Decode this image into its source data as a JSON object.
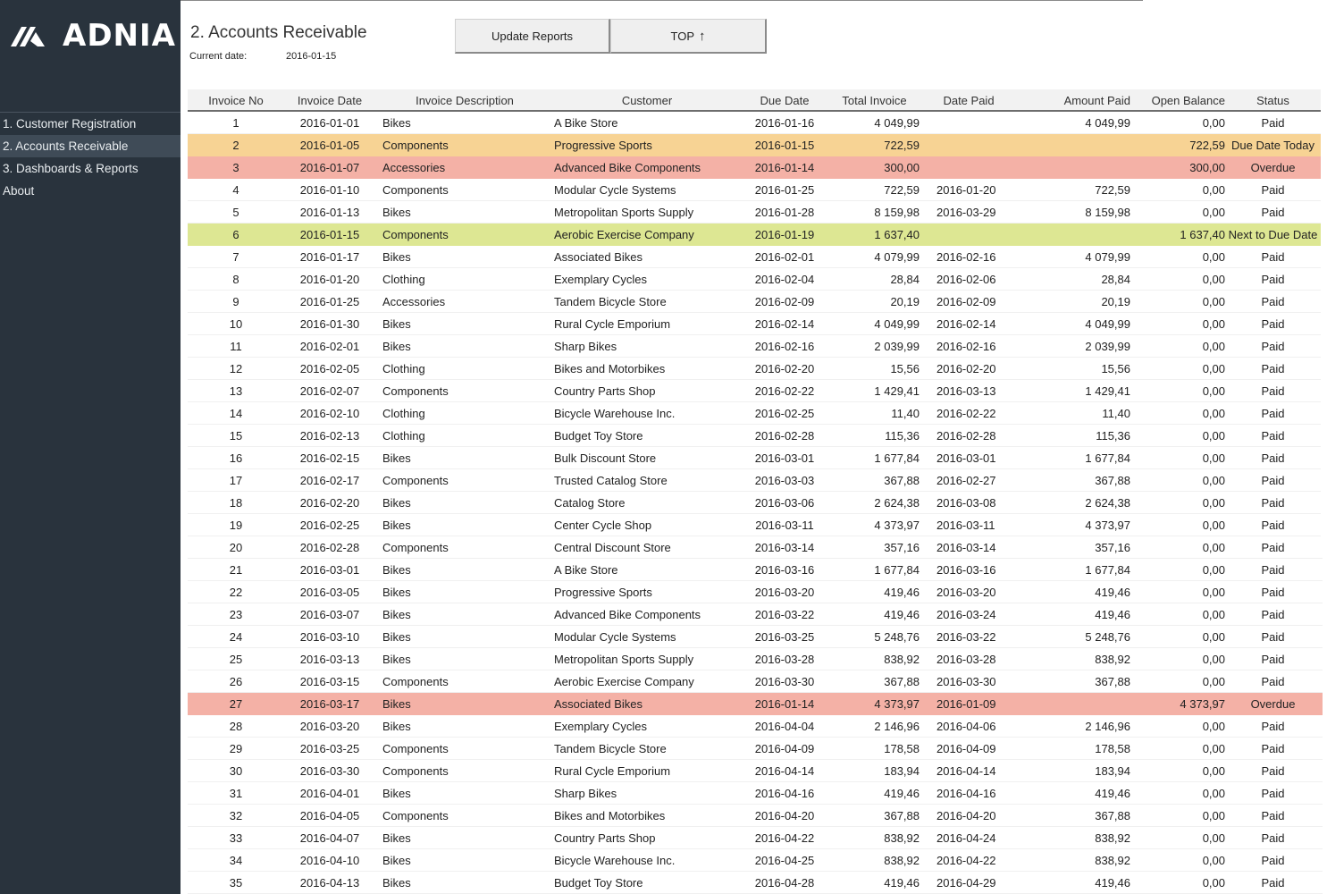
{
  "sidebar": {
    "logo_text": "ADNIA",
    "items": [
      {
        "label": "1. Customer Registration",
        "active": false
      },
      {
        "label": "2. Accounts Receivable",
        "active": true
      },
      {
        "label": "3. Dashboards & Reports",
        "active": false
      },
      {
        "label": "About",
        "active": false
      }
    ]
  },
  "header": {
    "title": "2. Accounts Receivable",
    "current_date_label": "Current date:",
    "current_date_value": "2016-01-15"
  },
  "toolbar": {
    "update_reports_label": "Update Reports",
    "top_label": "TOP",
    "top_arrow": "↑"
  },
  "status_colors": {
    "due_date_today": "#f7d394",
    "overdue": "#f4b1a6",
    "next_to_due_date": "#dde793",
    "paid": "#ffffff"
  },
  "table": {
    "columns": [
      "Invoice No",
      "Invoice Date",
      "Invoice Description",
      "Customer",
      "Due Date",
      "Total Invoice",
      "Date Paid",
      "Amount Paid",
      "Open Balance",
      "Status"
    ],
    "rows": [
      {
        "no": "1",
        "date": "2016-01-01",
        "desc": "Bikes",
        "customer": "A Bike Store",
        "due": "2016-01-16",
        "total": "4 049,99",
        "paid_date": "",
        "amount_paid": "4 049,99",
        "open": "0,00",
        "status": "Paid"
      },
      {
        "no": "2",
        "date": "2016-01-05",
        "desc": "Components",
        "customer": "Progressive Sports",
        "due": "2016-01-15",
        "total": "722,59",
        "paid_date": "",
        "amount_paid": "",
        "open": "722,59",
        "status": "Due Date Today"
      },
      {
        "no": "3",
        "date": "2016-01-07",
        "desc": "Accessories",
        "customer": "Advanced Bike Components",
        "due": "2016-01-14",
        "total": "300,00",
        "paid_date": "",
        "amount_paid": "",
        "open": "300,00",
        "status": "Overdue"
      },
      {
        "no": "4",
        "date": "2016-01-10",
        "desc": "Components",
        "customer": "Modular Cycle Systems",
        "due": "2016-01-25",
        "total": "722,59",
        "paid_date": "2016-01-20",
        "amount_paid": "722,59",
        "open": "0,00",
        "status": "Paid"
      },
      {
        "no": "5",
        "date": "2016-01-13",
        "desc": "Bikes",
        "customer": "Metropolitan Sports Supply",
        "due": "2016-01-28",
        "total": "8 159,98",
        "paid_date": "2016-03-29",
        "amount_paid": "8 159,98",
        "open": "0,00",
        "status": "Paid"
      },
      {
        "no": "6",
        "date": "2016-01-15",
        "desc": "Components",
        "customer": "Aerobic Exercise Company",
        "due": "2016-01-19",
        "total": "1 637,40",
        "paid_date": "",
        "amount_paid": "",
        "open": "1 637,40",
        "status": "Next to Due Date"
      },
      {
        "no": "7",
        "date": "2016-01-17",
        "desc": "Bikes",
        "customer": "Associated Bikes",
        "due": "2016-02-01",
        "total": "4 079,99",
        "paid_date": "2016-02-16",
        "amount_paid": "4 079,99",
        "open": "0,00",
        "status": "Paid"
      },
      {
        "no": "8",
        "date": "2016-01-20",
        "desc": "Clothing",
        "customer": "Exemplary Cycles",
        "due": "2016-02-04",
        "total": "28,84",
        "paid_date": "2016-02-06",
        "amount_paid": "28,84",
        "open": "0,00",
        "status": "Paid"
      },
      {
        "no": "9",
        "date": "2016-01-25",
        "desc": "Accessories",
        "customer": "Tandem Bicycle Store",
        "due": "2016-02-09",
        "total": "20,19",
        "paid_date": "2016-02-09",
        "amount_paid": "20,19",
        "open": "0,00",
        "status": "Paid"
      },
      {
        "no": "10",
        "date": "2016-01-30",
        "desc": "Bikes",
        "customer": "Rural Cycle Emporium",
        "due": "2016-02-14",
        "total": "4 049,99",
        "paid_date": "2016-02-14",
        "amount_paid": "4 049,99",
        "open": "0,00",
        "status": "Paid"
      },
      {
        "no": "11",
        "date": "2016-02-01",
        "desc": "Bikes",
        "customer": "Sharp Bikes",
        "due": "2016-02-16",
        "total": "2 039,99",
        "paid_date": "2016-02-16",
        "amount_paid": "2 039,99",
        "open": "0,00",
        "status": "Paid"
      },
      {
        "no": "12",
        "date": "2016-02-05",
        "desc": "Clothing",
        "customer": "Bikes and Motorbikes",
        "due": "2016-02-20",
        "total": "15,56",
        "paid_date": "2016-02-20",
        "amount_paid": "15,56",
        "open": "0,00",
        "status": "Paid"
      },
      {
        "no": "13",
        "date": "2016-02-07",
        "desc": "Components",
        "customer": "Country Parts Shop",
        "due": "2016-02-22",
        "total": "1 429,41",
        "paid_date": "2016-03-13",
        "amount_paid": "1 429,41",
        "open": "0,00",
        "status": "Paid"
      },
      {
        "no": "14",
        "date": "2016-02-10",
        "desc": "Clothing",
        "customer": "Bicycle Warehouse Inc.",
        "due": "2016-02-25",
        "total": "11,40",
        "paid_date": "2016-02-22",
        "amount_paid": "11,40",
        "open": "0,00",
        "status": "Paid"
      },
      {
        "no": "15",
        "date": "2016-02-13",
        "desc": "Clothing",
        "customer": "Budget Toy Store",
        "due": "2016-02-28",
        "total": "115,36",
        "paid_date": "2016-02-28",
        "amount_paid": "115,36",
        "open": "0,00",
        "status": "Paid"
      },
      {
        "no": "16",
        "date": "2016-02-15",
        "desc": "Bikes",
        "customer": "Bulk Discount Store",
        "due": "2016-03-01",
        "total": "1 677,84",
        "paid_date": "2016-03-01",
        "amount_paid": "1 677,84",
        "open": "0,00",
        "status": "Paid"
      },
      {
        "no": "17",
        "date": "2016-02-17",
        "desc": "Components",
        "customer": "Trusted Catalog Store",
        "due": "2016-03-03",
        "total": "367,88",
        "paid_date": "2016-02-27",
        "amount_paid": "367,88",
        "open": "0,00",
        "status": "Paid"
      },
      {
        "no": "18",
        "date": "2016-02-20",
        "desc": "Bikes",
        "customer": "Catalog Store",
        "due": "2016-03-06",
        "total": "2 624,38",
        "paid_date": "2016-03-08",
        "amount_paid": "2 624,38",
        "open": "0,00",
        "status": "Paid"
      },
      {
        "no": "19",
        "date": "2016-02-25",
        "desc": "Bikes",
        "customer": "Center Cycle Shop",
        "due": "2016-03-11",
        "total": "4 373,97",
        "paid_date": "2016-03-11",
        "amount_paid": "4 373,97",
        "open": "0,00",
        "status": "Paid"
      },
      {
        "no": "20",
        "date": "2016-02-28",
        "desc": "Components",
        "customer": "Central Discount Store",
        "due": "2016-03-14",
        "total": "357,16",
        "paid_date": "2016-03-14",
        "amount_paid": "357,16",
        "open": "0,00",
        "status": "Paid"
      },
      {
        "no": "21",
        "date": "2016-03-01",
        "desc": "Bikes",
        "customer": "A Bike Store",
        "due": "2016-03-16",
        "total": "1 677,84",
        "paid_date": "2016-03-16",
        "amount_paid": "1 677,84",
        "open": "0,00",
        "status": "Paid"
      },
      {
        "no": "22",
        "date": "2016-03-05",
        "desc": "Bikes",
        "customer": "Progressive Sports",
        "due": "2016-03-20",
        "total": "419,46",
        "paid_date": "2016-03-20",
        "amount_paid": "419,46",
        "open": "0,00",
        "status": "Paid"
      },
      {
        "no": "23",
        "date": "2016-03-07",
        "desc": "Bikes",
        "customer": "Advanced Bike Components",
        "due": "2016-03-22",
        "total": "419,46",
        "paid_date": "2016-03-24",
        "amount_paid": "419,46",
        "open": "0,00",
        "status": "Paid"
      },
      {
        "no": "24",
        "date": "2016-03-10",
        "desc": "Bikes",
        "customer": "Modular Cycle Systems",
        "due": "2016-03-25",
        "total": "5 248,76",
        "paid_date": "2016-03-22",
        "amount_paid": "5 248,76",
        "open": "0,00",
        "status": "Paid"
      },
      {
        "no": "25",
        "date": "2016-03-13",
        "desc": "Bikes",
        "customer": "Metropolitan Sports Supply",
        "due": "2016-03-28",
        "total": "838,92",
        "paid_date": "2016-03-28",
        "amount_paid": "838,92",
        "open": "0,00",
        "status": "Paid"
      },
      {
        "no": "26",
        "date": "2016-03-15",
        "desc": "Components",
        "customer": "Aerobic Exercise Company",
        "due": "2016-03-30",
        "total": "367,88",
        "paid_date": "2016-03-30",
        "amount_paid": "367,88",
        "open": "0,00",
        "status": "Paid"
      },
      {
        "no": "27",
        "date": "2016-03-17",
        "desc": "Bikes",
        "customer": "Associated Bikes",
        "due": "2016-01-14",
        "total": "4 373,97",
        "paid_date": "2016-01-09",
        "amount_paid": "",
        "open": "4 373,97",
        "status": "Overdue"
      },
      {
        "no": "28",
        "date": "2016-03-20",
        "desc": "Bikes",
        "customer": "Exemplary Cycles",
        "due": "2016-04-04",
        "total": "2 146,96",
        "paid_date": "2016-04-06",
        "amount_paid": "2 146,96",
        "open": "0,00",
        "status": "Paid"
      },
      {
        "no": "29",
        "date": "2016-03-25",
        "desc": "Components",
        "customer": "Tandem Bicycle Store",
        "due": "2016-04-09",
        "total": "178,58",
        "paid_date": "2016-04-09",
        "amount_paid": "178,58",
        "open": "0,00",
        "status": "Paid"
      },
      {
        "no": "30",
        "date": "2016-03-30",
        "desc": "Components",
        "customer": "Rural Cycle Emporium",
        "due": "2016-04-14",
        "total": "183,94",
        "paid_date": "2016-04-14",
        "amount_paid": "183,94",
        "open": "0,00",
        "status": "Paid"
      },
      {
        "no": "31",
        "date": "2016-04-01",
        "desc": "Bikes",
        "customer": "Sharp Bikes",
        "due": "2016-04-16",
        "total": "419,46",
        "paid_date": "2016-04-16",
        "amount_paid": "419,46",
        "open": "0,00",
        "status": "Paid"
      },
      {
        "no": "32",
        "date": "2016-04-05",
        "desc": "Components",
        "customer": "Bikes and Motorbikes",
        "due": "2016-04-20",
        "total": "367,88",
        "paid_date": "2016-04-20",
        "amount_paid": "367,88",
        "open": "0,00",
        "status": "Paid"
      },
      {
        "no": "33",
        "date": "2016-04-07",
        "desc": "Bikes",
        "customer": "Country Parts Shop",
        "due": "2016-04-22",
        "total": "838,92",
        "paid_date": "2016-04-24",
        "amount_paid": "838,92",
        "open": "0,00",
        "status": "Paid"
      },
      {
        "no": "34",
        "date": "2016-04-10",
        "desc": "Bikes",
        "customer": "Bicycle Warehouse Inc.",
        "due": "2016-04-25",
        "total": "838,92",
        "paid_date": "2016-04-22",
        "amount_paid": "838,92",
        "open": "0,00",
        "status": "Paid"
      },
      {
        "no": "35",
        "date": "2016-04-13",
        "desc": "Bikes",
        "customer": "Budget Toy Store",
        "due": "2016-04-28",
        "total": "419,46",
        "paid_date": "2016-04-29",
        "amount_paid": "419,46",
        "open": "0,00",
        "status": "Paid"
      }
    ]
  }
}
